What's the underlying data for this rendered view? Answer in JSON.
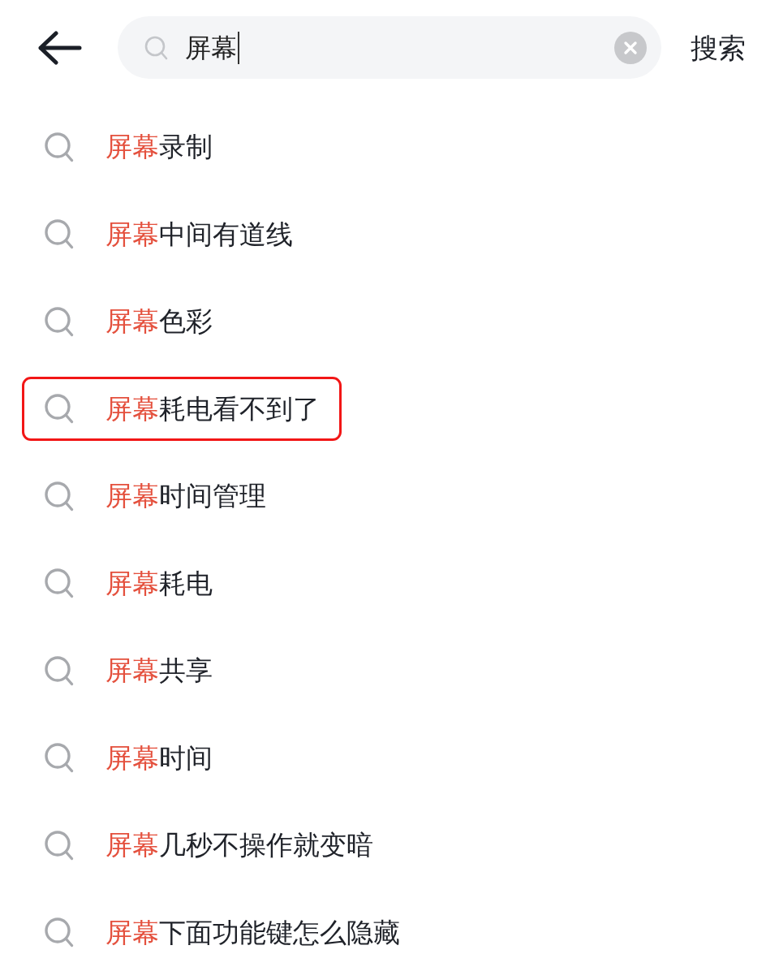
{
  "search_bar": {
    "query": "屏幕",
    "focused": true,
    "submit_label": "搜索"
  },
  "suggestions": [
    {
      "match": "屏幕",
      "rest": "录制",
      "highlighted": false
    },
    {
      "match": "屏幕",
      "rest": "中间有道线",
      "highlighted": false
    },
    {
      "match": "屏幕",
      "rest": "色彩",
      "highlighted": false
    },
    {
      "match": "屏幕",
      "rest": "耗电看不到了",
      "highlighted": true
    },
    {
      "match": "屏幕",
      "rest": "时间管理",
      "highlighted": false
    },
    {
      "match": "屏幕",
      "rest": "耗电",
      "highlighted": false
    },
    {
      "match": "屏幕",
      "rest": "共享",
      "highlighted": false
    },
    {
      "match": "屏幕",
      "rest": "时间",
      "highlighted": false
    },
    {
      "match": "屏幕",
      "rest": "几秒不操作就变暗",
      "highlighted": false
    },
    {
      "match": "屏幕",
      "rest": "下面功能键怎么隐藏",
      "highlighted": false
    }
  ]
}
